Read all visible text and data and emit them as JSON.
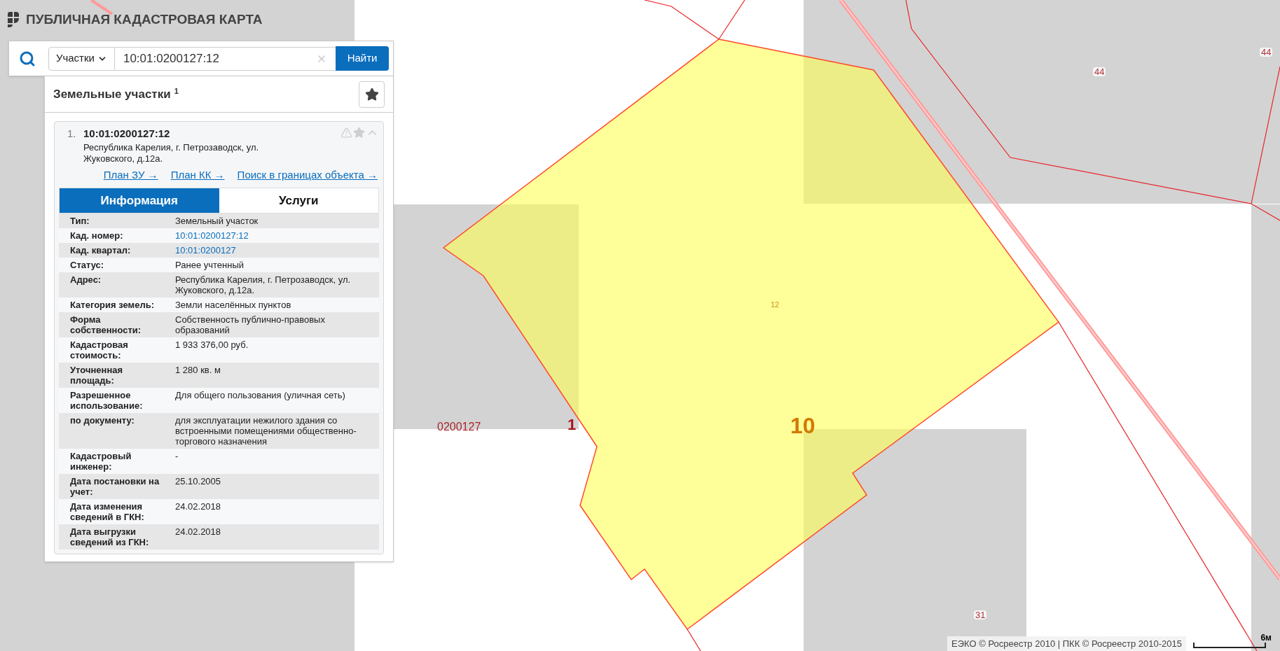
{
  "header": {
    "title": "ПУБЛИЧНАЯ КАДАСТРОВАЯ КАРТА"
  },
  "search": {
    "category": "Участки",
    "value": "10:01:0200127:12",
    "button": "Найти"
  },
  "panel": {
    "title": "Земельные участки",
    "count": "1",
    "results": [
      {
        "index": "1.",
        "number": "10:01:0200127:12",
        "address": "Республика Карелия, г. Петрозаводск, ул. Жуковского, д.12а.",
        "links": [
          "План ЗУ →",
          "План КК →",
          "Поиск в границах объекта →"
        ],
        "tabs": [
          {
            "label": "Информация",
            "selected": true
          },
          {
            "label": "Услуги",
            "selected": false
          }
        ],
        "fields": [
          {
            "label": "Тип:",
            "value": "Земельный участок",
            "kind": "text"
          },
          {
            "label": "Кад. номер:",
            "value": "10:01:0200127:12",
            "kind": "link"
          },
          {
            "label": "Кад. квартал:",
            "value": "10:01:0200127",
            "kind": "link"
          },
          {
            "label": "Статус:",
            "value": "Ранее учтенный",
            "kind": "text"
          },
          {
            "label": "Адрес:",
            "value": "Республика Карелия, г. Петрозаводск, ул. Жуковского, д.12а.",
            "kind": "text"
          },
          {
            "label": "Категория земель:",
            "value": "Земли населённых пунктов",
            "kind": "text"
          },
          {
            "label": "Форма собственности:",
            "value": "Собственность публично-правовых образований",
            "kind": "text"
          },
          {
            "label": "Кадастровая стоимость:",
            "value": "1 933 376,00 руб.",
            "kind": "text"
          },
          {
            "label": "Уточненная площадь:",
            "value": "1 280 кв. м",
            "kind": "text"
          },
          {
            "label": "Разрешенное использование:",
            "value": "Для общего пользования (уличная сеть)",
            "kind": "text"
          },
          {
            "label": "по документу:",
            "value": "для эксплуатации нежилого здания со встроенными помещениями общественно-торгового назначения",
            "kind": "text"
          },
          {
            "label": "Кадастровый инженер:",
            "value": "-",
            "kind": "text"
          },
          {
            "label": "Дата постановки на учет:",
            "value": "25.10.2005",
            "kind": "text"
          },
          {
            "label": "Дата изменения сведений в ГКН:",
            "value": "24.02.2018",
            "kind": "text"
          },
          {
            "label": "Дата выгрузки сведений из ГКН:",
            "value": "24.02.2018",
            "kind": "text"
          }
        ]
      }
    ]
  },
  "map": {
    "labels": [
      {
        "text": "44",
        "kind": "plot"
      },
      {
        "text": "44",
        "kind": "plot"
      },
      {
        "text": "12",
        "kind": "small"
      },
      {
        "text": "0200127",
        "kind": "quarter"
      },
      {
        "text": "1",
        "kind": "block"
      },
      {
        "text": "10",
        "kind": "large"
      },
      {
        "text": "31",
        "kind": "plot"
      }
    ],
    "attribution": "ЕЭКО © Росреестр 2010 | ПКК © Росреестр 2010-2015",
    "scale": "6м"
  }
}
